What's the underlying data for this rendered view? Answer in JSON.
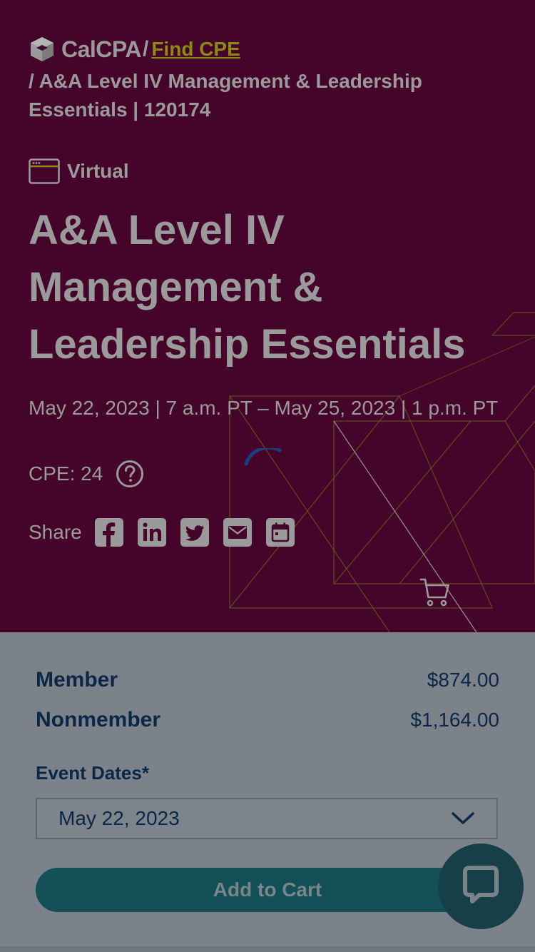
{
  "breadcrumb": {
    "logo_text": "CalCPA",
    "separator": "/",
    "link_label": "Find CPE",
    "current": "/ A&A Level IV Management & Leadership Essentials | 120174"
  },
  "event": {
    "format": "Virtual",
    "title": "A&A Level IV Management & Leadership Essentials",
    "dates": "May 22, 2023 | 7 a.m. PT – May 25, 2023 | 1 p.m. PT",
    "cpe": "CPE: 24",
    "share_label": "Share"
  },
  "share_icons": [
    "facebook-icon",
    "linkedin-icon",
    "twitter-icon",
    "email-icon",
    "calendar-icon"
  ],
  "pricing": {
    "member_label": "Member",
    "member_price": "$874.00",
    "nonmember_label": "Nonmember",
    "nonmember_price": "$1,164.00"
  },
  "form": {
    "dates_label": "Event Dates*",
    "selected_date": "May 22, 2023",
    "add_to_cart": "Add to Cart"
  },
  "colors": {
    "hero_bg": "#45052b",
    "overlay_text": "#9a9a9a",
    "link": "#8a8a12",
    "navy": "#0c2647",
    "teal_button": "#134f56",
    "chat": "#163f47"
  }
}
